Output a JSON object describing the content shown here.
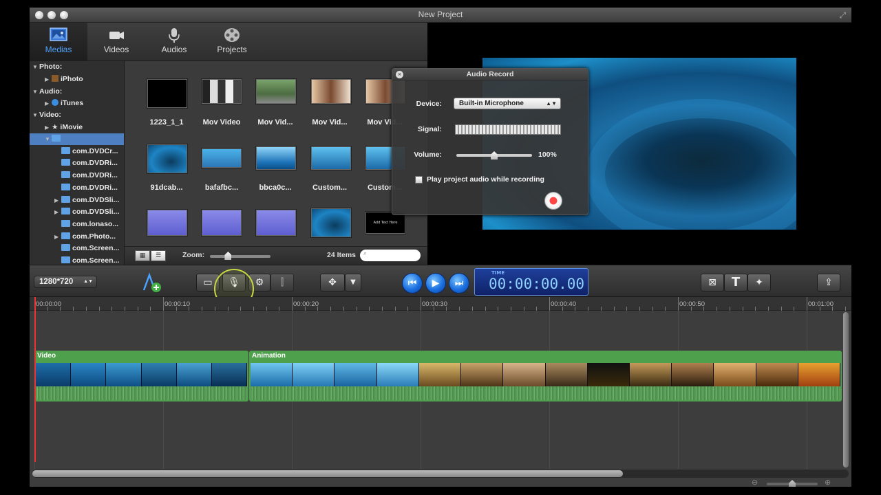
{
  "window": {
    "title": "New Project"
  },
  "library_tabs": [
    {
      "label": "Medias",
      "icon": "photo-icon"
    },
    {
      "label": "Videos",
      "icon": "video-camera-icon"
    },
    {
      "label": "Audios",
      "icon": "microphone-icon"
    },
    {
      "label": "Projects",
      "icon": "film-reel-icon"
    }
  ],
  "tree": {
    "photo_header": "Photo:",
    "iphoto": "iPhoto",
    "audio_header": "Audio:",
    "itunes": "iTunes",
    "video_header": "Video:",
    "imovie": "iMovie",
    "folders": [
      "com.DVDCr...",
      "com.DVDRi...",
      "com.DVDRi...",
      "com.DVDRi...",
      "com.DVDSli...",
      "com.DVDSli...",
      "com.lonaso...",
      "com.Photo...",
      "com.Screen...",
      "com.Screen..."
    ]
  },
  "media_items": [
    {
      "label": "1223_1_1"
    },
    {
      "label": "Mov Video"
    },
    {
      "label": "Mov Vid..."
    },
    {
      "label": "Mov Vid..."
    },
    {
      "label": "Mov Vid..."
    },
    {
      "label": "91dcab..."
    },
    {
      "label": "bafafbc..."
    },
    {
      "label": "bbca0c..."
    },
    {
      "label": "Custom..."
    },
    {
      "label": "Custom..."
    }
  ],
  "grid_footer": {
    "zoom_label": "Zoom:",
    "zoom_level": 0.3,
    "item_count": "24 Items"
  },
  "thumbnail_caption": "Add Text Here",
  "audio_record": {
    "title": "Audio Record",
    "device_label": "Device:",
    "device_value": "Built-in Microphone",
    "signal_label": "Signal:",
    "volume_label": "Volume:",
    "volume_value": "100%",
    "volume_level": 0.5,
    "play_audio_label": "Play project audio while recording",
    "play_audio_checked": false
  },
  "toolbar": {
    "resolution": "1280*720",
    "time_label": "TIME",
    "time_value": "00:00:00.00"
  },
  "timeline": {
    "ruler_ticks": [
      "00:00:00",
      "00:00:10",
      "00:00:20",
      "00:00:30",
      "00:00:40",
      "00:00:50",
      "00:01:00"
    ],
    "clips": [
      {
        "label": "Video"
      },
      {
        "label": "Animation"
      }
    ]
  },
  "colors": {
    "accent_blue": "#4aa3ff",
    "clip_green": "#4ea04c",
    "playhead_red": "#e33333",
    "timecode_blue": "#8fd0ff"
  }
}
